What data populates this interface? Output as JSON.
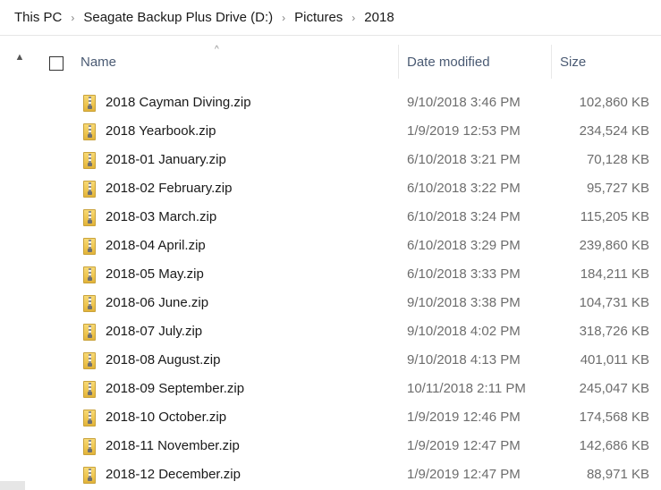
{
  "breadcrumb": {
    "items": [
      "This PC",
      "Seagate Backup Plus Drive (D:)",
      "Pictures",
      "2018"
    ],
    "separator": "›"
  },
  "columns": {
    "name": "Name",
    "date_modified": "Date modified",
    "size": "Size",
    "sort_indicator": "^"
  },
  "files": [
    {
      "name": "2018 Cayman Diving.zip",
      "date": "9/10/2018 3:46 PM",
      "size": "102,860 KB"
    },
    {
      "name": "2018 Yearbook.zip",
      "date": "1/9/2019 12:53 PM",
      "size": "234,524 KB"
    },
    {
      "name": "2018-01 January.zip",
      "date": "6/10/2018 3:21 PM",
      "size": "70,128 KB"
    },
    {
      "name": "2018-02 February.zip",
      "date": "6/10/2018 3:22 PM",
      "size": "95,727 KB"
    },
    {
      "name": "2018-03 March.zip",
      "date": "6/10/2018 3:24 PM",
      "size": "115,205 KB"
    },
    {
      "name": "2018-04 April.zip",
      "date": "6/10/2018 3:29 PM",
      "size": "239,860 KB"
    },
    {
      "name": "2018-05 May.zip",
      "date": "6/10/2018 3:33 PM",
      "size": "184,211 KB"
    },
    {
      "name": "2018-06 June.zip",
      "date": "9/10/2018 3:38 PM",
      "size": "104,731 KB"
    },
    {
      "name": "2018-07 July.zip",
      "date": "9/10/2018 4:02 PM",
      "size": "318,726 KB"
    },
    {
      "name": "2018-08 August.zip",
      "date": "9/10/2018 4:13 PM",
      "size": "401,011 KB"
    },
    {
      "name": "2018-09 September.zip",
      "date": "10/11/2018 2:11 PM",
      "size": "245,047 KB"
    },
    {
      "name": "2018-10 October.zip",
      "date": "1/9/2019 12:46 PM",
      "size": "174,568 KB"
    },
    {
      "name": "2018-11 November.zip",
      "date": "1/9/2019 12:47 PM",
      "size": "142,686 KB"
    },
    {
      "name": "2018-12 December.zip",
      "date": "1/9/2019 12:47 PM",
      "size": "88,971 KB"
    }
  ],
  "icons": {
    "file": "zip-archive-icon",
    "collapse": "chevron-up-icon"
  },
  "colors": {
    "header_text": "#4a5a73",
    "secondary_text": "#6d6d6d",
    "zip_icon": "#eec54e"
  }
}
